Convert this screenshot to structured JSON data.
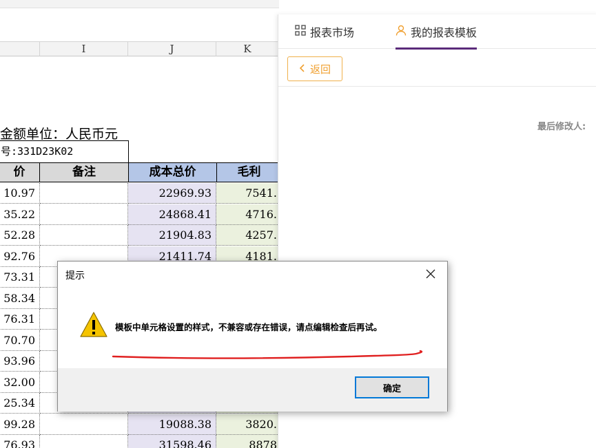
{
  "sheet": {
    "columns": [
      "I",
      "J",
      "K"
    ],
    "unit_text": "金额单位：人民币元",
    "code_text": "号:331D23K02",
    "headers": [
      "价",
      "备注",
      "成本总价",
      "毛利"
    ],
    "col_h_values": [
      "10.97",
      "35.22",
      "52.28",
      "92.76",
      "73.31",
      "58.34",
      "76.31",
      "70.70",
      "93.96",
      "32.00",
      "25.34",
      "99.28",
      "76.93"
    ],
    "col_j_values": [
      "22969.93",
      "24868.41",
      "21904.83",
      "21411.74",
      "",
      "",
      "",
      "",
      "",
      "",
      "",
      "19088.38",
      "31598.46"
    ],
    "col_k_values": [
      "7541.",
      "4716.",
      "4257.",
      "4181.",
      "",
      "",
      "",
      "",
      "",
      "",
      "",
      "3820.",
      "8878"
    ],
    "colors": {
      "header_blue": "#b4c6e7",
      "header_gray": "#d9d9d9",
      "cost_bg": "#e6e3f2",
      "profit_bg": "#ebf1de"
    }
  },
  "panel": {
    "tabs": [
      {
        "label": "报表市场",
        "icon": "grid-icon"
      },
      {
        "label": "我的报表模板",
        "icon": "user-icon"
      }
    ],
    "back_label": "返回",
    "last_modified_label": "最后修改人:",
    "colors": {
      "accent_purple": "#5a2a7a",
      "back_orange": "#f0a030"
    }
  },
  "dialog": {
    "title": "提示",
    "message": "模板中单元格设置的样式，不兼容或存在错误，请点编辑检查后再试。",
    "ok_label": "确定",
    "icon": "warning-icon",
    "colors": {
      "ok_border": "#0078d7",
      "annotation_red": "#e02020",
      "warning_yellow": "#f5c400"
    }
  }
}
